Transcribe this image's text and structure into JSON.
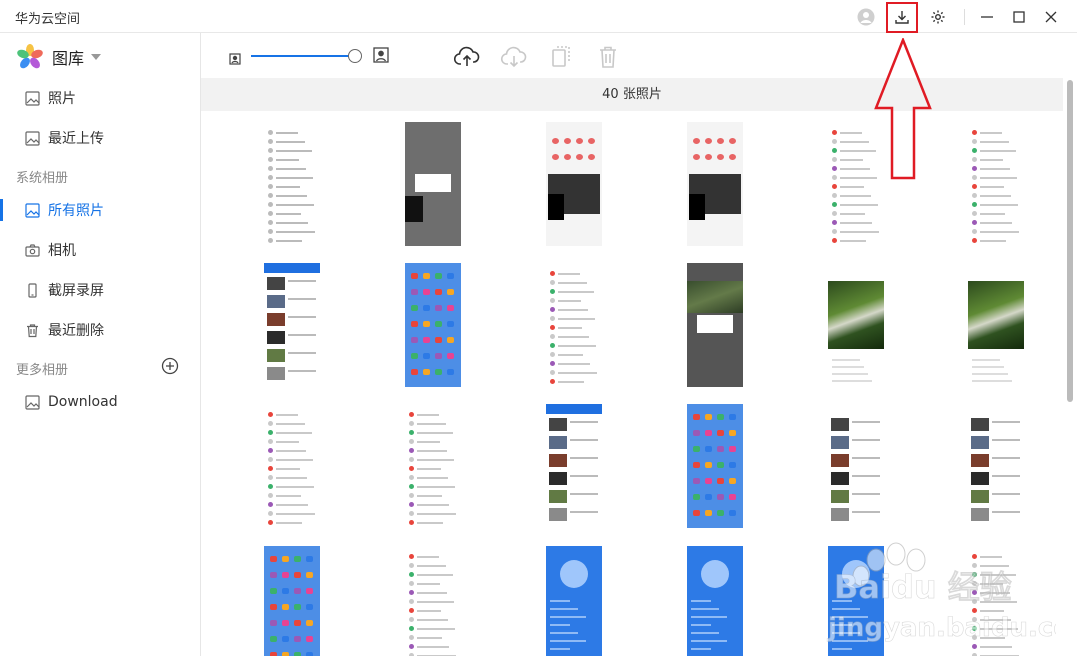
{
  "app": {
    "title": "华为云空间"
  },
  "sidebar": {
    "gallery_label": "图库",
    "items": [
      {
        "label": "照片",
        "icon": "image-icon"
      },
      {
        "label": "最近上传",
        "icon": "image-icon"
      }
    ],
    "system_albums_label": "系统相册",
    "system_items": [
      {
        "label": "所有照片",
        "icon": "image-icon",
        "active": true
      },
      {
        "label": "相机",
        "icon": "camera-icon"
      },
      {
        "label": "截屏录屏",
        "icon": "phone-icon"
      },
      {
        "label": "最近删除",
        "icon": "trash-icon"
      }
    ],
    "more_albums_label": "更多相册",
    "more_items": [
      {
        "label": "Download",
        "icon": "image-icon"
      }
    ]
  },
  "toolbar": {
    "zoom_level": 1.0,
    "actions": [
      "upload-icon",
      "cloud-download-icon",
      "copy-icon",
      "trash-icon"
    ]
  },
  "photo_count_label": "40 张照片",
  "thumbnails": [
    {
      "style": "doc"
    },
    {
      "style": "dark"
    },
    {
      "style": "app"
    },
    {
      "style": "app"
    },
    {
      "style": "list"
    },
    {
      "style": "list"
    },
    {
      "style": "news"
    },
    {
      "style": "home"
    },
    {
      "style": "list"
    },
    {
      "style": "darkmodal"
    },
    {
      "style": "nature"
    },
    {
      "style": "nature"
    },
    {
      "style": "list"
    },
    {
      "style": "list"
    },
    {
      "style": "news"
    },
    {
      "style": "home"
    },
    {
      "style": "video"
    },
    {
      "style": "video"
    },
    {
      "style": "home"
    },
    {
      "style": "list"
    },
    {
      "style": "music"
    },
    {
      "style": "music"
    },
    {
      "style": "music"
    },
    {
      "style": "list"
    }
  ],
  "watermark": {
    "brand": "Baidu 经验",
    "site": "jingyan.baidu.com"
  },
  "colors": {
    "accent": "#1673e6",
    "annotation": "#e01b24"
  }
}
